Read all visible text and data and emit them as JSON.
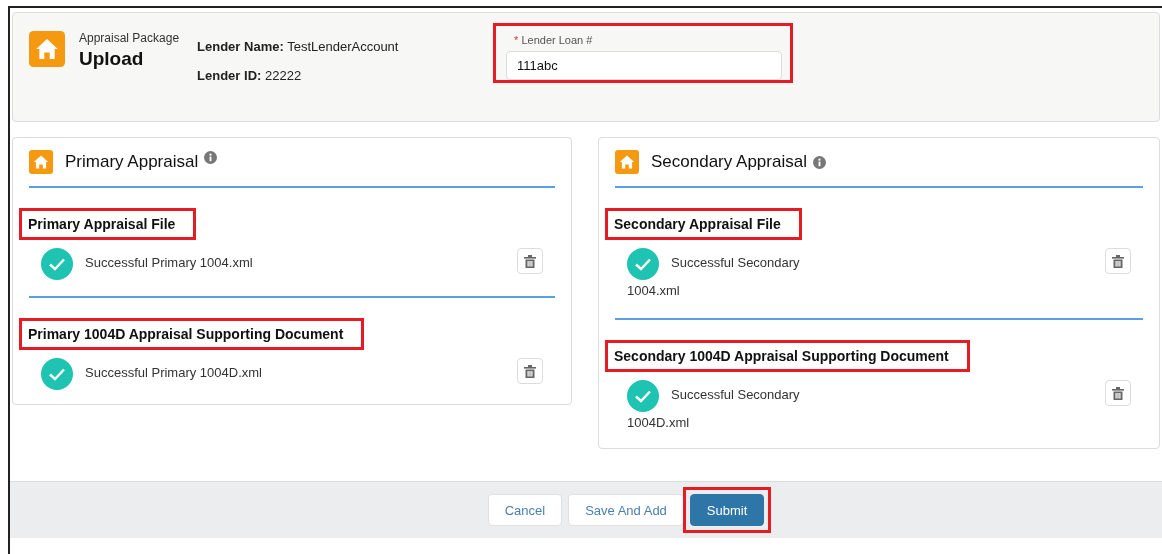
{
  "header": {
    "subtitle": "Appraisal Package",
    "title": "Upload",
    "fields": [
      {
        "label": "Lender Name:",
        "value": "TestLenderAccount"
      },
      {
        "label": "Lender ID:",
        "value": "22222"
      }
    ],
    "loan_field": {
      "required_mark": "*",
      "label": "Lender Loan #",
      "value": "111abc",
      "highlighted": true
    }
  },
  "cards": [
    {
      "title": "Primary Appraisal",
      "wrap": false,
      "sections": [
        {
          "heading": "Primary Appraisal File",
          "highlighted": true,
          "file": "Successful Primary 1004.xml",
          "uploaded": true
        },
        {
          "heading": "Primary 1004D Appraisal Supporting Document",
          "highlighted": true,
          "file": "Successful Primary 1004D.xml",
          "uploaded": true
        }
      ]
    },
    {
      "title": "Secondary Appraisal",
      "wrap": true,
      "sections": [
        {
          "heading": "Secondary Appraisal File",
          "highlighted": true,
          "file": "Successful Secondary 1004.xml",
          "uploaded": true
        },
        {
          "heading": "Secondary 1004D Appraisal Supporting Document",
          "highlighted": true,
          "file": "Successful Secondary 1004D.xml",
          "uploaded": true
        }
      ]
    }
  ],
  "footer": {
    "buttons": [
      {
        "label": "Cancel",
        "kind": "neutral",
        "highlighted": false
      },
      {
        "label": "Save And Add",
        "kind": "neutral",
        "highlighted": false
      },
      {
        "label": "Submit",
        "kind": "brand",
        "highlighted": true
      }
    ]
  }
}
